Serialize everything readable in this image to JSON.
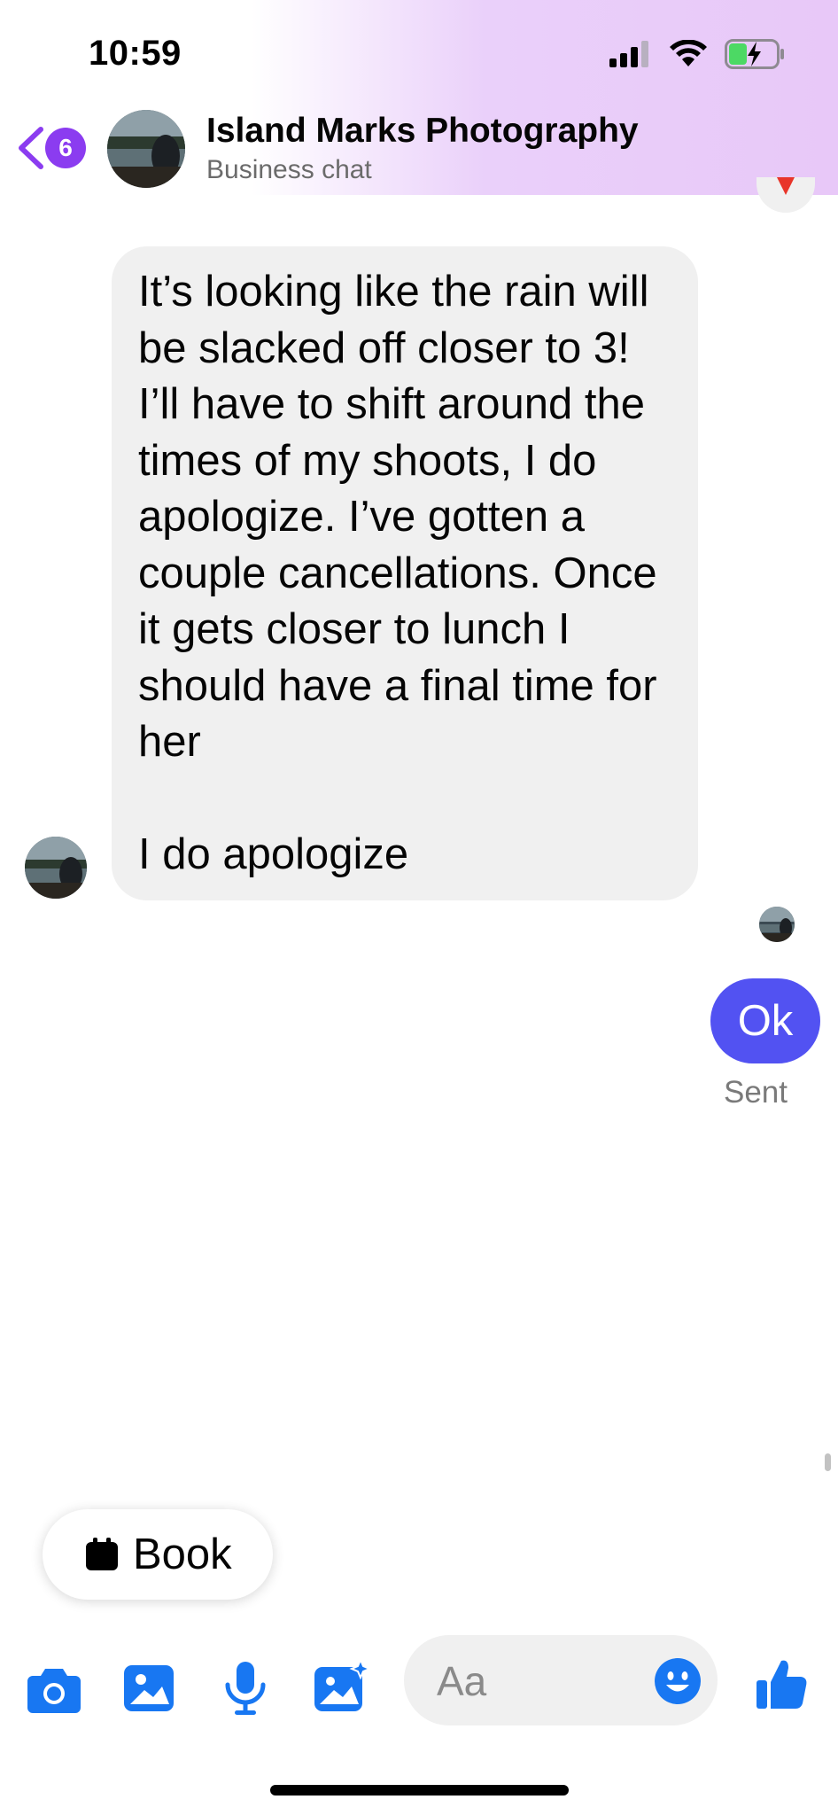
{
  "status_bar": {
    "time": "10:59",
    "icons": [
      "cellular-signal-icon",
      "wifi-icon",
      "battery-charging-icon"
    ]
  },
  "header": {
    "back_icon": "chevron-left-icon",
    "unread_count": "6",
    "title": "Island Marks Photography",
    "subtitle": "Business chat",
    "avatar": "business-avatar"
  },
  "messages": {
    "received": {
      "paragraph_1": "It’s looking like the rain will be slacked off closer to 3! I’ll have to shift around the times of my shoots, I do apologize. I’ve gotten a couple cancellations. Once it gets closer to lunch I should have a final time for her",
      "paragraph_2": "I do apologize"
    },
    "sent": {
      "text": "Ok",
      "status": "Sent"
    }
  },
  "quick_reply": {
    "icon": "calendar-icon",
    "label": "Book"
  },
  "composer": {
    "placeholder": "Aa",
    "icons": [
      "camera-icon",
      "photo-icon",
      "microphone-icon",
      "sticker-gallery-icon",
      "emoji-icon",
      "thumbs-up-icon"
    ]
  },
  "colors": {
    "accent": "#1877f2",
    "sent_bubble": "#5252f2",
    "badge": "#8b3cf0",
    "received_bubble": "#f0f0f0"
  }
}
